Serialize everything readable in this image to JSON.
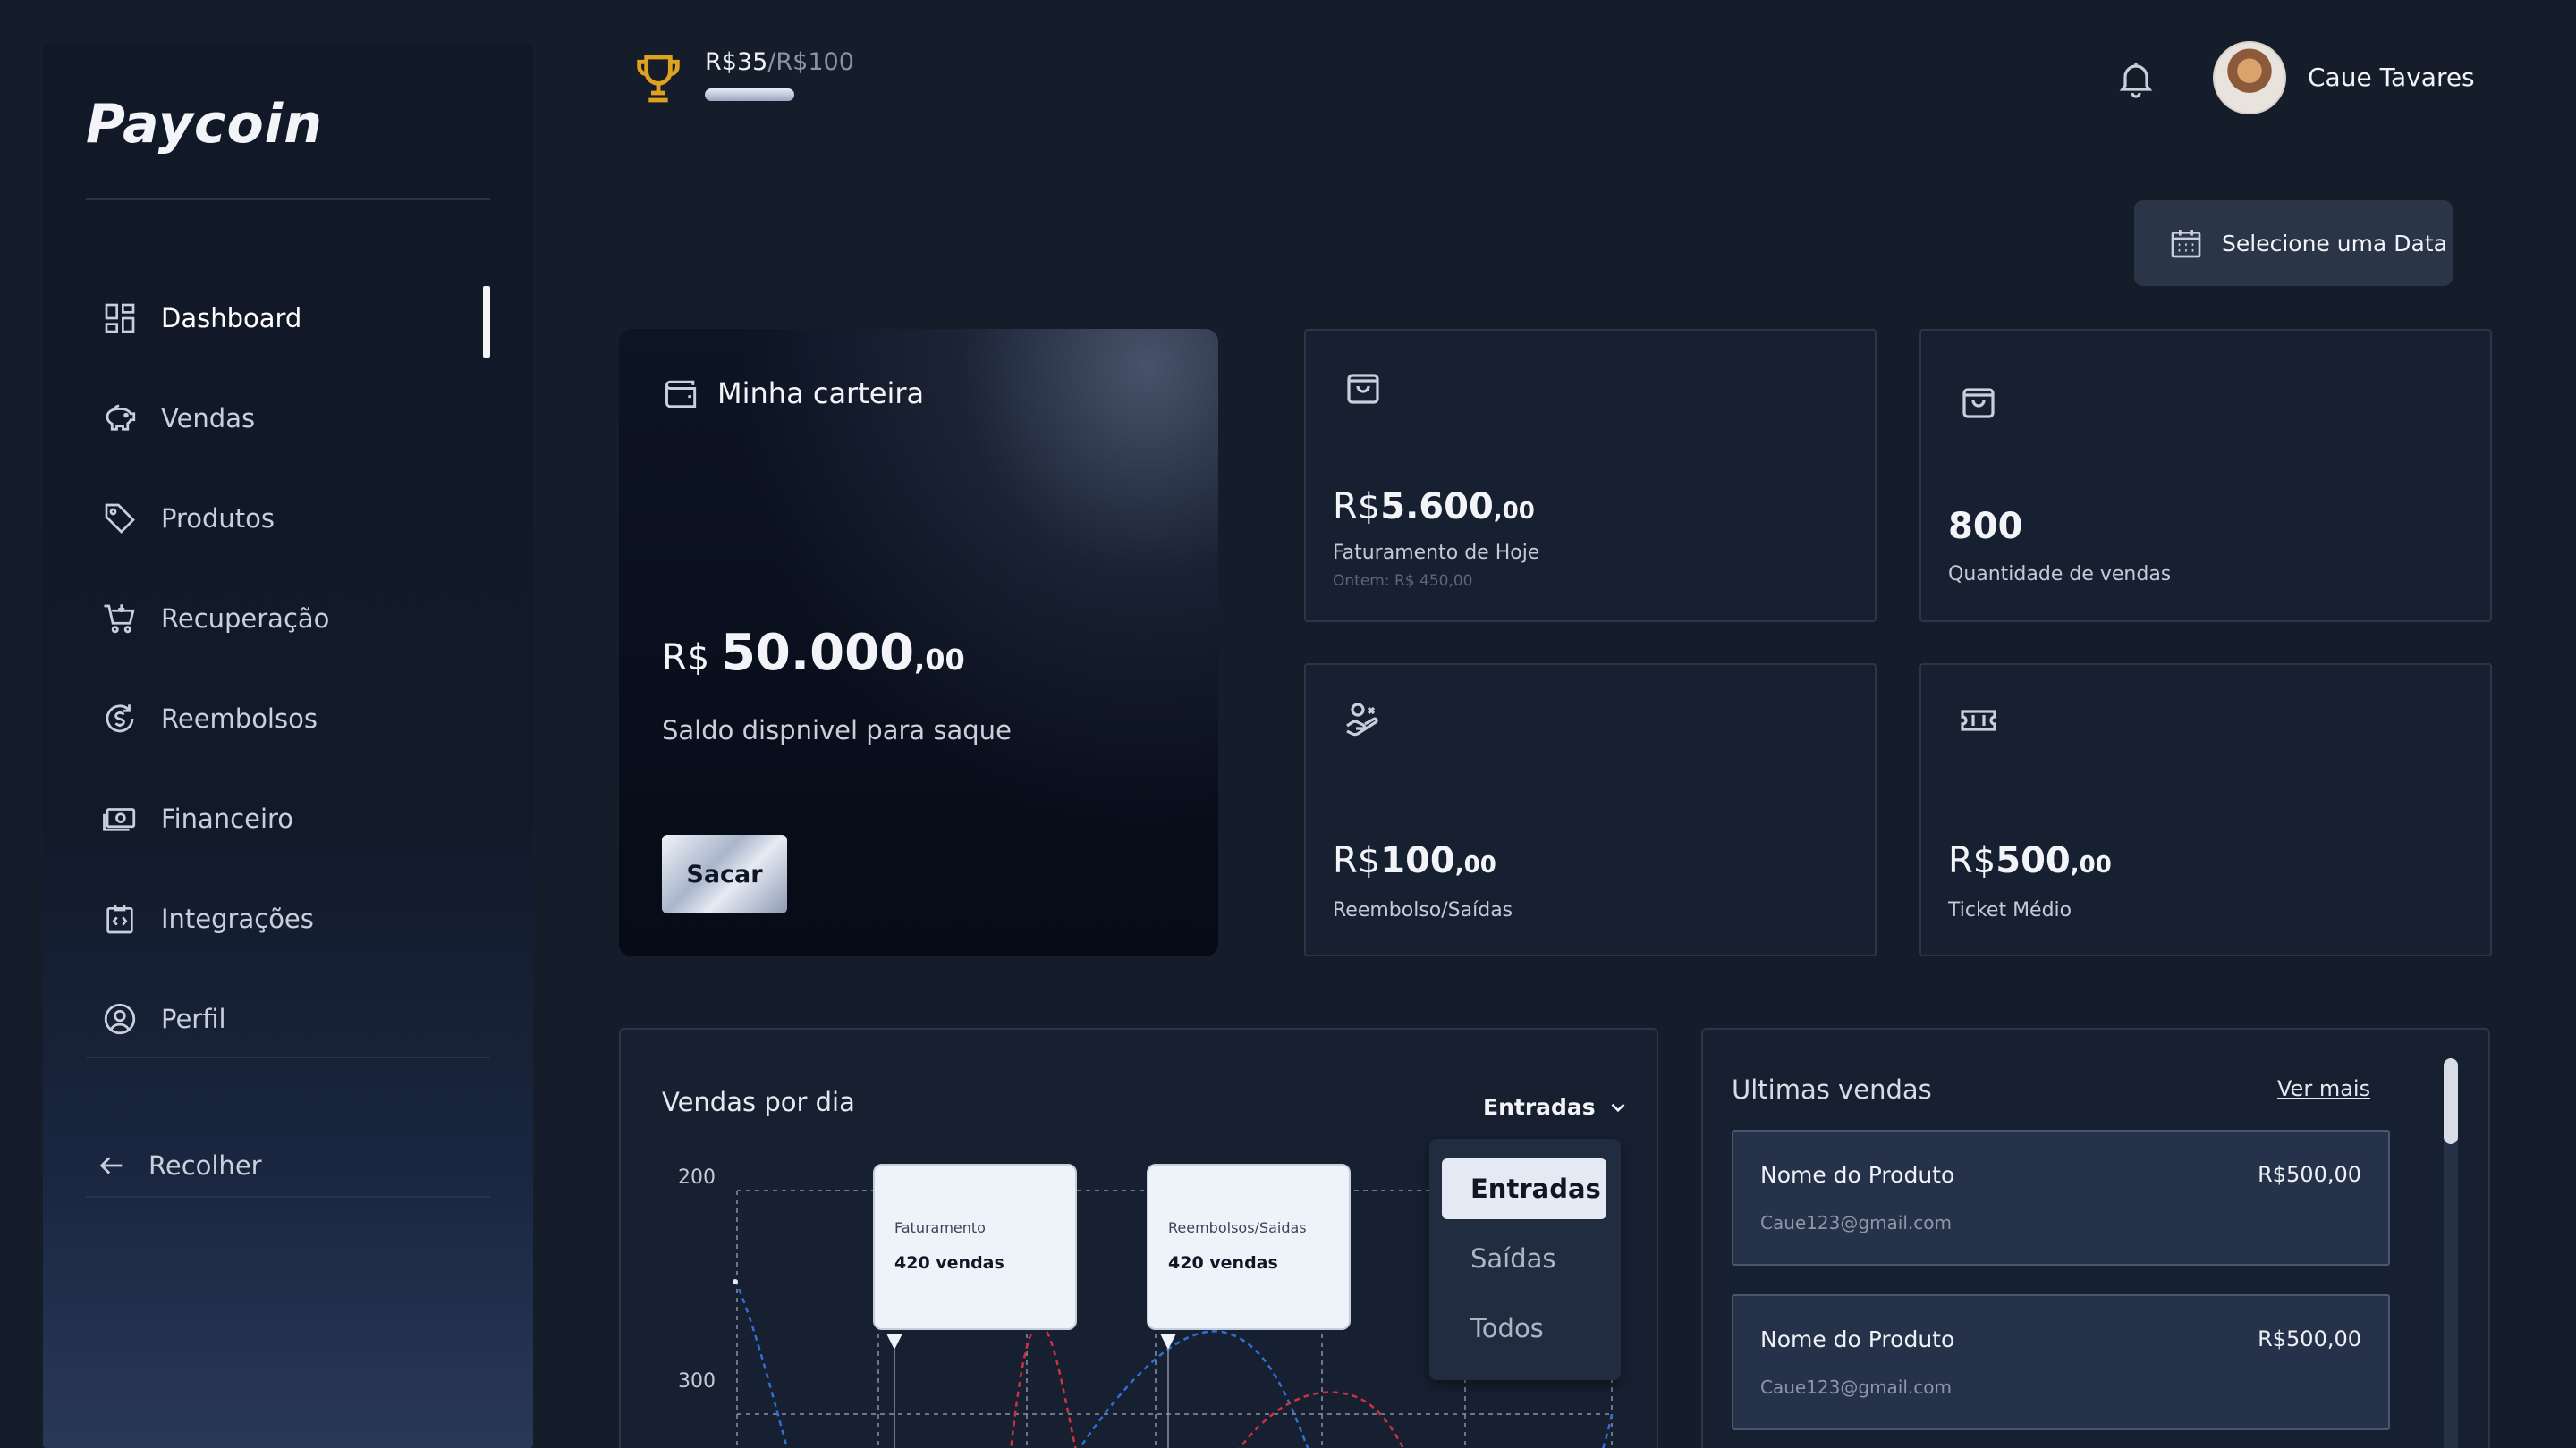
{
  "app": {
    "logo": "Paycoin"
  },
  "sidebar": {
    "items": [
      {
        "label": "Dashboard",
        "icon": "dashboard-icon",
        "active": true
      },
      {
        "label": "Vendas",
        "icon": "piggy-bank-icon"
      },
      {
        "label": "Produtos",
        "icon": "tag-icon"
      },
      {
        "label": "Recuperação",
        "icon": "cart-icon"
      },
      {
        "label": "Reembolsos",
        "icon": "refund-icon"
      },
      {
        "label": "Financeiro",
        "icon": "money-icon"
      },
      {
        "label": "Integrações",
        "icon": "integration-icon"
      },
      {
        "label": "Perfil",
        "icon": "profile-icon"
      }
    ],
    "collapse_label": "Recolher"
  },
  "header": {
    "goal_current": "R$35",
    "goal_target": "/R$100",
    "goal_progress": 0.35,
    "user_name": "Caue Tavares"
  },
  "date_button": {
    "label": "Selecione uma Data"
  },
  "wallet": {
    "title": "Minha carteira",
    "currency": "R$",
    "amount": "50.000",
    "cents": ",00",
    "subtitle": "Saldo dispnivel para saque",
    "withdraw_label": "Sacar"
  },
  "stats": [
    {
      "currency": "R$",
      "value": "5.600",
      "cents": ",00",
      "label": "Faturamento de Hoje",
      "note": "Ontem: R$ 450,00",
      "icon": "shopping-bag-icon"
    },
    {
      "currency": "",
      "value": "800",
      "cents": "",
      "label": "Quantidade de vendas",
      "note": "",
      "icon": "shopping-bag-icon"
    },
    {
      "currency": "R$",
      "value": "100",
      "cents": ",00",
      "label": "Reembolso/Saídas",
      "note": "",
      "icon": "hand-refund-icon"
    },
    {
      "currency": "R$",
      "value": "500",
      "cents": ",00",
      "label": "Ticket Médio",
      "note": "",
      "icon": "ticket-icon"
    }
  ],
  "chart": {
    "title": "Vendas por dia",
    "filter_selected": "Entradas",
    "filter_options": [
      "Entradas",
      "Saídas",
      "Todos"
    ],
    "tooltips": [
      {
        "label": "Faturamento",
        "value": "420 vendas"
      },
      {
        "label": "Reembolsos/Saidas",
        "value": "420 vendas"
      }
    ]
  },
  "chart_data": {
    "type": "line",
    "title": "Vendas por dia",
    "y_ticks": [
      200,
      300
    ],
    "series": [
      {
        "name": "Faturamento",
        "color": "#2f6fd6"
      },
      {
        "name": "Reembolsos/Saidas",
        "color": "#d0313f"
      }
    ]
  },
  "sales": {
    "title": "Ultimas vendas",
    "see_more": "Ver mais",
    "items": [
      {
        "name": "Nome do Produto",
        "price": "R$500,00",
        "email": "Caue123@gmail.com"
      },
      {
        "name": "Nome do Produto",
        "price": "R$500,00",
        "email": "Caue123@gmail.com"
      }
    ]
  },
  "colors": {
    "background": "#151d2b",
    "card": "#172031",
    "accent_gold": "#e0a020",
    "series_blue": "#2f6fd6",
    "series_red": "#d0313f"
  }
}
